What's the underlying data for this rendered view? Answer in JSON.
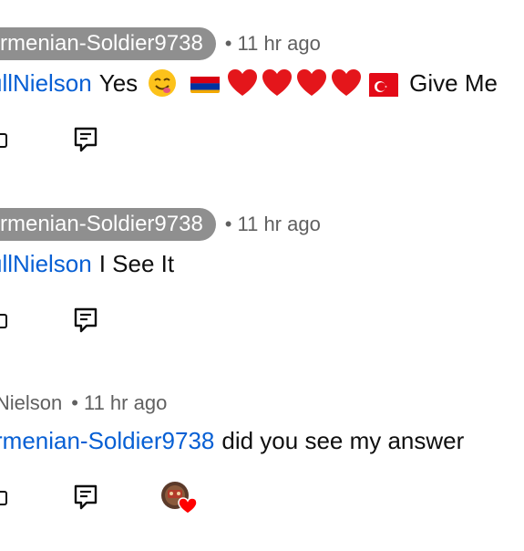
{
  "comments": [
    {
      "author": "rmenian-Soldier9738",
      "separator": "•",
      "time": "11 hr ago",
      "mention": "ullNielson",
      "text_before": "Yes",
      "text_after": "Give Me"
    },
    {
      "author": "rmenian-Soldier9738",
      "separator": "•",
      "time": "11 hr ago",
      "mention": "ullNielson",
      "text": "I See It"
    },
    {
      "author": "lNielson",
      "separator": "•",
      "time": "11 hr ago",
      "mention": "rmenian-Soldier9738",
      "text": "did you see my answer"
    }
  ],
  "icons": {
    "reply": "reply-comment-icon",
    "dislike": "dislike-icon",
    "heart": "creator-heart-icon"
  },
  "colors": {
    "mention": "#065fd4",
    "pill_bg": "#8f8f8f",
    "meta": "#606060",
    "heart": "#ff0000"
  }
}
